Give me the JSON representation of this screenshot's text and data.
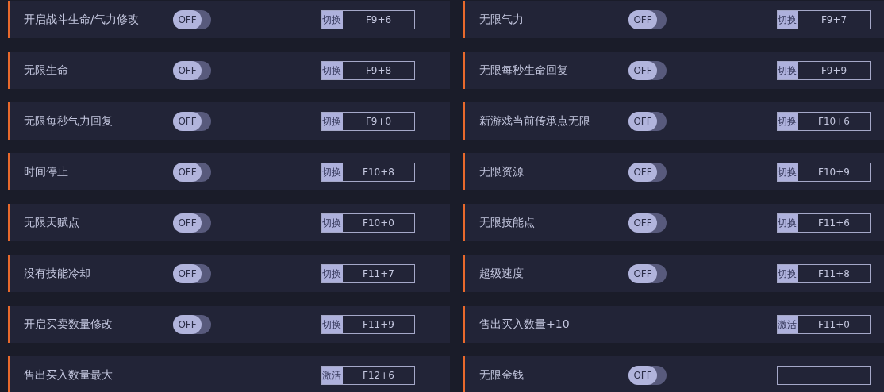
{
  "cheats": [
    {
      "label": "开启战斗生命/气力修改",
      "toggle": {
        "on": false,
        "text": "OFF"
      },
      "mode": "切换",
      "key": "F9+6"
    },
    {
      "label": "无限气力",
      "toggle": {
        "on": false,
        "text": "OFF"
      },
      "mode": "切换",
      "key": "F9+7"
    },
    {
      "label": "无限生命",
      "toggle": {
        "on": false,
        "text": "OFF"
      },
      "mode": "切换",
      "key": "F9+8"
    },
    {
      "label": "无限每秒生命回复",
      "toggle": {
        "on": false,
        "text": "OFF"
      },
      "mode": "切换",
      "key": "F9+9"
    },
    {
      "label": "无限每秒气力回复",
      "toggle": {
        "on": false,
        "text": "OFF"
      },
      "mode": "切换",
      "key": "F9+0"
    },
    {
      "label": "新游戏当前传承点无限",
      "toggle": {
        "on": false,
        "text": "OFF"
      },
      "mode": "切换",
      "key": "F10+6"
    },
    {
      "label": "时间停止",
      "toggle": {
        "on": false,
        "text": "OFF"
      },
      "mode": "切换",
      "key": "F10+8"
    },
    {
      "label": "无限资源",
      "toggle": {
        "on": false,
        "text": "OFF"
      },
      "mode": "切换",
      "key": "F10+9"
    },
    {
      "label": "无限天赋点",
      "toggle": {
        "on": false,
        "text": "OFF"
      },
      "mode": "切换",
      "key": "F10+0"
    },
    {
      "label": "无限技能点",
      "toggle": {
        "on": false,
        "text": "OFF"
      },
      "mode": "切换",
      "key": "F11+6"
    },
    {
      "label": "没有技能冷却",
      "toggle": {
        "on": false,
        "text": "OFF"
      },
      "mode": "切换",
      "key": "F11+7"
    },
    {
      "label": "超级速度",
      "toggle": {
        "on": false,
        "text": "OFF"
      },
      "mode": "切换",
      "key": "F11+8"
    },
    {
      "label": "开启买卖数量修改",
      "toggle": {
        "on": false,
        "text": "OFF"
      },
      "mode": "切换",
      "key": "F11+9"
    },
    {
      "label": "售出买入数量+10",
      "mode": "激活",
      "key": "F11+0"
    },
    {
      "label": "售出买入数量最大",
      "mode": "激活",
      "key": "F12+6"
    },
    {
      "label": "无限金钱",
      "toggle": {
        "on": false,
        "text": "OFF"
      }
    }
  ]
}
